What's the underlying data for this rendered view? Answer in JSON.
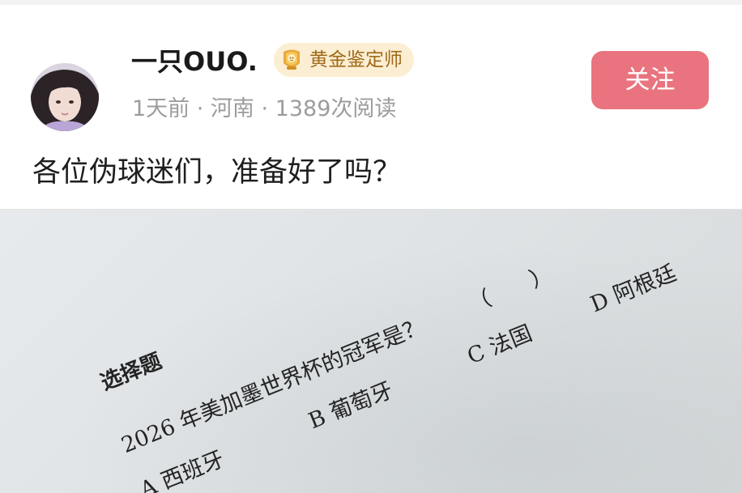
{
  "post": {
    "username": "一只OUO.",
    "badge_label": "黄金鉴定师",
    "badge_icon": "gold-appraiser-icon",
    "meta": "1天前 · 河南 · 1389次阅读",
    "follow_label": "关注",
    "text": "各位伪球迷们，准备好了吗？"
  },
  "worksheet": {
    "heading": "选择题",
    "question": "2026 年美加墨世界杯的冠军是？",
    "answer_paren": "（　　）",
    "options": [
      "A 西班牙",
      "B 葡萄牙",
      "C 法国",
      "D 阿根廷"
    ]
  },
  "colors": {
    "follow_button": "#e9747f",
    "badge_background": "#fbeed2",
    "badge_text": "#a06a18",
    "meta_text": "#9c9c9c"
  }
}
